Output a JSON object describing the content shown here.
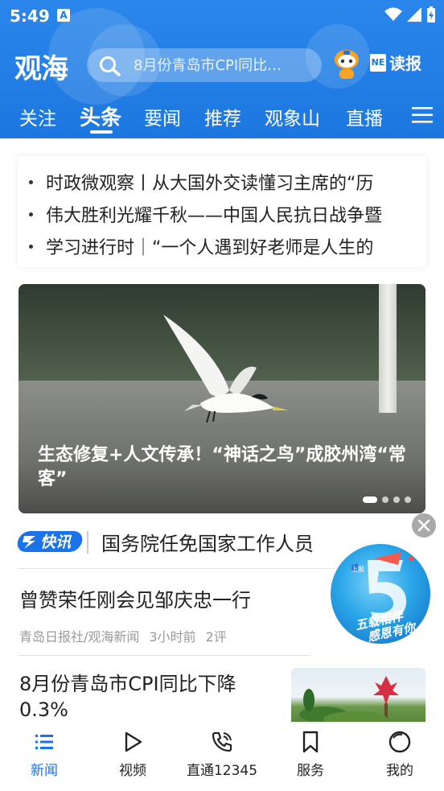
{
  "status_bar": {
    "time": "5:49",
    "app_badge": "A"
  },
  "header": {
    "logo": "观海",
    "search": {
      "placeholder": "8月份青岛市CPI同比…"
    },
    "ai_label": "AI",
    "read_news_icon_text": "NE",
    "read_news_label": "读报"
  },
  "tabs": [
    {
      "label": "关注"
    },
    {
      "label": "头条",
      "active": true
    },
    {
      "label": "要闻"
    },
    {
      "label": "推荐"
    },
    {
      "label": "观象山"
    },
    {
      "label": "直播"
    }
  ],
  "ticker": [
    "时政微观察丨从大国外交读懂习主席的“历",
    "伟大胜利光耀千秋——中国人民抗日战争暨",
    "学习进行时｜“一个人遇到好老师是人生的"
  ],
  "hero": {
    "title": "生态修复+人文传承！“神话之鸟”成胶州湾“常客”",
    "slide_count": 4,
    "active_slide": 1
  },
  "flash": {
    "badge": "快讯",
    "text": "国务院任免国家工作人员"
  },
  "news": [
    {
      "title": "曾赞荣任刚会见邹庆忠一行",
      "source": "青岛日报社/观海新闻",
      "time": "3小时前",
      "comments": "2评"
    },
    {
      "title": "8月份青岛市CPI同比下降0.3%"
    }
  ],
  "floating_ad": {
    "top_tag": "上报",
    "text_line1": "五载相伴",
    "text_line2": "感恩有你"
  },
  "bottom_nav": [
    {
      "label": "新闻",
      "icon": "news-list-icon",
      "active": true
    },
    {
      "label": "视频",
      "icon": "play-icon"
    },
    {
      "label": "直通12345",
      "icon": "phone-call-icon"
    },
    {
      "label": "服务",
      "icon": "bookmark-icon"
    },
    {
      "label": "我的",
      "icon": "profile-icon"
    }
  ],
  "colors": {
    "brand_blue": "#1c78e0",
    "accent_blue": "#1a73e8"
  }
}
